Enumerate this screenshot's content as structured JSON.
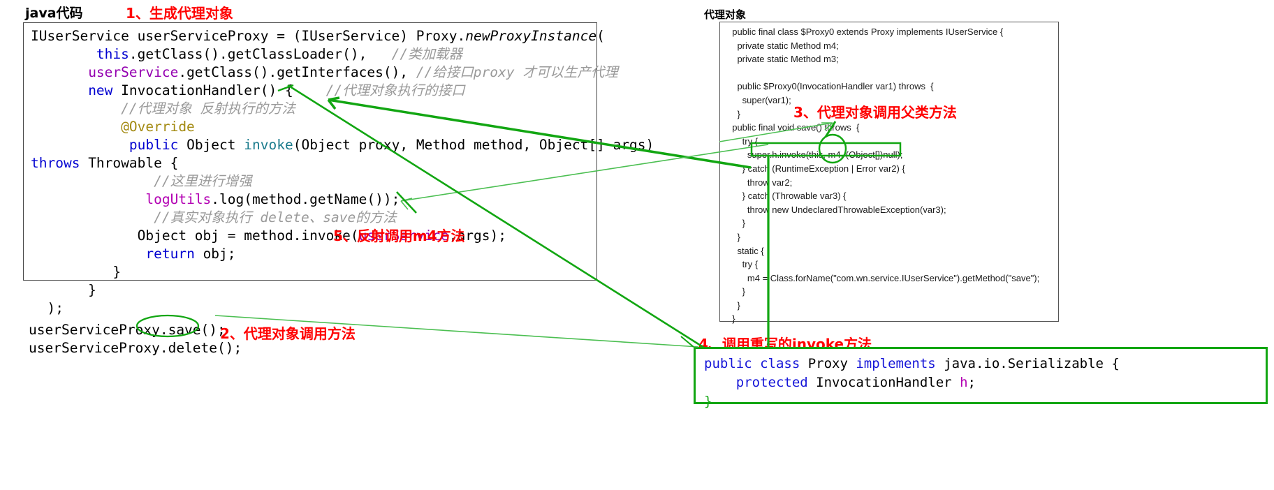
{
  "headings": {
    "java_code": "java代码",
    "proxy_object": "代理对象"
  },
  "annotations": {
    "step1": "1、生成代理对象",
    "step2": "2、代理对象调用方法",
    "step3": "3、代理对象调用父类方法",
    "step4": "4、调用重写的invoke方法",
    "step5": "5、反射调用m4方法"
  },
  "left_code": {
    "lines": [
      [
        {
          "t": "IUserService userServiceProxy = (IUserService) Proxy.",
          "c": "plain"
        },
        {
          "t": "newProxyInstance",
          "c": "italic-m"
        },
        {
          "t": "(",
          "c": "plain"
        }
      ],
      [
        {
          "t": "        ",
          "c": "plain"
        },
        {
          "t": "this",
          "c": "kw"
        },
        {
          "t": ".getClass().getClassLoader(),   ",
          "c": "plain"
        },
        {
          "t": "//类加载器",
          "c": "cmt"
        }
      ],
      [
        {
          "t": "       ",
          "c": "plain"
        },
        {
          "t": "userService",
          "c": "purple"
        },
        {
          "t": ".getClass().getInterfaces(), ",
          "c": "plain"
        },
        {
          "t": "//给接口proxy 才可以生产代理",
          "c": "cmt"
        }
      ],
      [
        {
          "t": "       ",
          "c": "plain"
        },
        {
          "t": "new",
          "c": "kw"
        },
        {
          "t": " InvocationHandler() {    ",
          "c": "plain"
        },
        {
          "t": "//代理对象执行的接口",
          "c": "cmt"
        }
      ],
      [
        {
          "t": "           ",
          "c": "plain"
        },
        {
          "t": "//代理对象 反射执行的方法",
          "c": "cmt"
        }
      ],
      [
        {
          "t": "           ",
          "c": "plain"
        },
        {
          "t": "@Override",
          "c": "ann"
        }
      ],
      [
        {
          "t": "            ",
          "c": "plain"
        },
        {
          "t": "public",
          "c": "kw"
        },
        {
          "t": " Object ",
          "c": "plain"
        },
        {
          "t": "invoke",
          "c": "teal"
        },
        {
          "t": "(Object proxy, Method method, Object[] args)",
          "c": "plain"
        }
      ],
      [
        {
          "t": "throws",
          "c": "kw"
        },
        {
          "t": " Throwable {",
          "c": "plain"
        }
      ],
      [
        {
          "t": "               ",
          "c": "plain"
        },
        {
          "t": "//这里进行增强",
          "c": "cmt"
        }
      ],
      [
        {
          "t": "              ",
          "c": "plain"
        },
        {
          "t": "logUtils",
          "c": "magenta"
        },
        {
          "t": ".log(method.getName());",
          "c": "plain"
        }
      ],
      [
        {
          "t": "               ",
          "c": "plain"
        },
        {
          "t": "//真实对象执行 delete、save的方法",
          "c": "cmt"
        }
      ],
      [
        {
          "t": "             ",
          "c": "plain"
        },
        {
          "t": "Object obj = method.invoke(",
          "c": "plain"
        },
        {
          "t": "userService",
          "c": "purple"
        },
        {
          "t": ",args);",
          "c": "plain"
        }
      ],
      [
        {
          "t": "              ",
          "c": "plain"
        },
        {
          "t": "return",
          "c": "kw"
        },
        {
          "t": " obj;",
          "c": "plain"
        }
      ],
      [
        {
          "t": "          }",
          "c": "plain"
        }
      ],
      [
        {
          "t": "       }",
          "c": "plain"
        }
      ],
      [
        {
          "t": "  );",
          "c": "plain"
        }
      ]
    ]
  },
  "bottom_calls": {
    "lines": [
      "userServiceProxy.save();",
      "userServiceProxy.delete();"
    ]
  },
  "right_code": {
    "lines": [
      "  public final class $Proxy0 extends Proxy implements IUserService {",
      "    private static Method m4;",
      "    private static Method m3;",
      "",
      "    public $Proxy0(InvocationHandler var1) throws  {",
      "      super(var1);",
      "    }",
      "  public final void save() throws  {",
      "      try {",
      "        super.h.invoke(this, m4, (Object[])null);",
      "      } catch (RuntimeException | Error var2) {",
      "        throw var2;",
      "      } catch (Throwable var3) {",
      "        throw new UndeclaredThrowableException(var3);",
      "      }",
      "    }",
      "    static {",
      "      try {",
      "        m4 = Class.forName(\"com.wn.service.IUserService\").getMethod(\"save\");",
      "      }",
      "    }",
      "  }"
    ]
  },
  "proxy_class": {
    "lines": [
      [
        {
          "t": "public class",
          "c": "kw"
        },
        {
          "t": " Proxy ",
          "c": "plain"
        },
        {
          "t": "implements",
          "c": "kw"
        },
        {
          "t": " java.io.Serializable {",
          "c": "plain"
        }
      ],
      [
        {
          "t": "    ",
          "c": "plain"
        },
        {
          "t": "protected",
          "c": "kw"
        },
        {
          "t": " InvocationHandler ",
          "c": "plain"
        },
        {
          "t": "h",
          "c": "magenta"
        },
        {
          "t": ";",
          "c": "plain"
        }
      ],
      [
        {
          "t": "}",
          "c": "green"
        }
      ]
    ]
  },
  "colors": {
    "accent_red": "#ff0000",
    "accent_green": "#12a612",
    "comment_gray": "#9a9a9a",
    "keyword_blue": "#0000d0",
    "purple": "#9400b0"
  }
}
